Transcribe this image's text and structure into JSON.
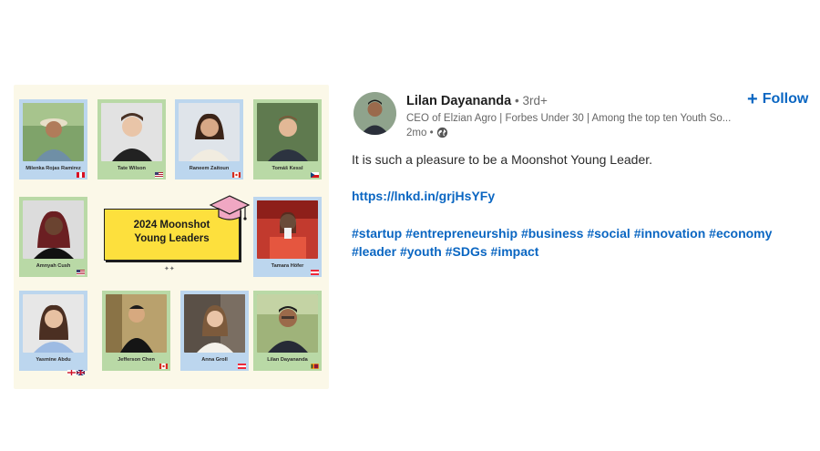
{
  "post": {
    "author": {
      "name": "Lilan Dayananda",
      "degree": " • 3rd+",
      "headline": "CEO of Elzian Agro | Forbes Under 30 | Among the top ten Youth So...",
      "time": "2mo •",
      "visibility_icon": "globe-icon"
    },
    "follow_label": "Follow",
    "text": "It is such a pleasure to be a Moonshot Young Leader.",
    "link": "https://lnkd.in/grjHsYFy",
    "hashtags": [
      "#startup",
      "#entrepreneurship",
      "#business",
      "#social",
      "#innovation",
      "#economy",
      "#leader",
      "#youth",
      "#SDGs",
      "#impact"
    ]
  },
  "image": {
    "banner": {
      "line1": "2024 Moonshot",
      "line2": "Young Leaders"
    },
    "leaders": [
      {
        "name": "Milenka Rojas Ramirez",
        "flag": "peru"
      },
      {
        "name": "Tate Wilson",
        "flag": "usa"
      },
      {
        "name": "Raneem Zaitoun",
        "flag": "canada"
      },
      {
        "name": "Tomáš Kessl",
        "flag": "czech"
      },
      {
        "name": "Amnyah Cush",
        "flag": "usa"
      },
      {
        "name": "Tamara Höfer",
        "flag": "austria"
      },
      {
        "name": "Yasmine Abdu",
        "flag": "england-uk"
      },
      {
        "name": "Jefferson Chen",
        "flag": "canada"
      },
      {
        "name": "Anna Groll",
        "flag": "austria"
      },
      {
        "name": "Lilan Dayananda",
        "flag": "sri-lanka"
      }
    ]
  }
}
